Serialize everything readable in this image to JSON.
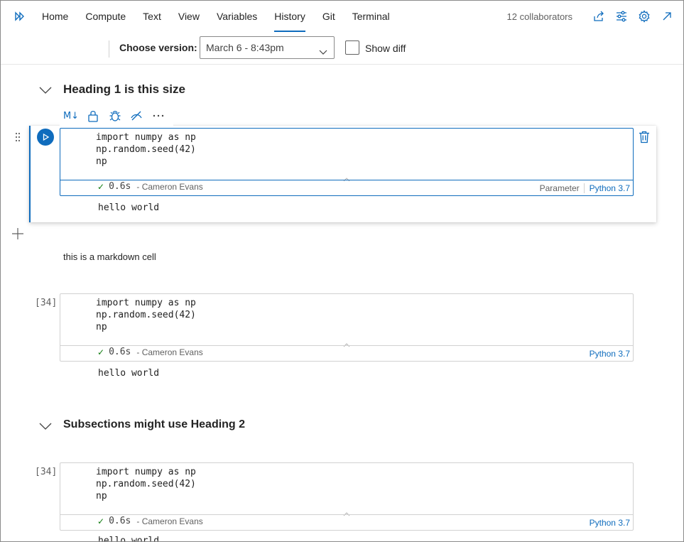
{
  "nav": {
    "menu": [
      "Home",
      "Compute",
      "Text",
      "View",
      "Variables",
      "History",
      "Git",
      "Terminal"
    ],
    "active": "History",
    "collaborators": "12 collaborators",
    "icons": [
      "expand-panel-icon",
      "share-icon",
      "filter-settings-icon",
      "gear-icon",
      "open-external-icon"
    ]
  },
  "version_bar": {
    "label": "Choose version:",
    "selected": "March 6 - 8:43pm",
    "show_diff_label": "Show diff",
    "show_diff_checked": false
  },
  "notebook": {
    "heading1": "Heading 1 is this size",
    "toolbar_icons": [
      "markdown-icon",
      "lock-icon",
      "bug-icon",
      "hide-icon",
      "more-icon"
    ],
    "toolbar_md": "M↓",
    "markdown_cell": "this is a markdown cell",
    "heading2": "Subsections might use Heading 2",
    "cells": [
      {
        "exec_count": "",
        "code": "import numpy as np\nnp.random.seed(42)\nnp",
        "time": "0.6s",
        "author": "- Cameron Evans",
        "tag": "Parameter",
        "kernel": "Python 3.7",
        "output": "hello world"
      },
      {
        "exec_count": "[34]",
        "code": "import numpy as np\nnp.random.seed(42)\nnp",
        "time": "0.6s",
        "author": "- Cameron Evans",
        "kernel": "Python 3.7",
        "output": "hello world"
      },
      {
        "exec_count": "[34]",
        "code": "import numpy as np\nnp.random.seed(42)\nnp",
        "time": "0.6s",
        "author": "- Cameron Evans",
        "kernel": "Python 3.7",
        "output": "hello world"
      }
    ]
  },
  "colors": {
    "accent": "#0f6cbd",
    "success": "#107c10"
  }
}
